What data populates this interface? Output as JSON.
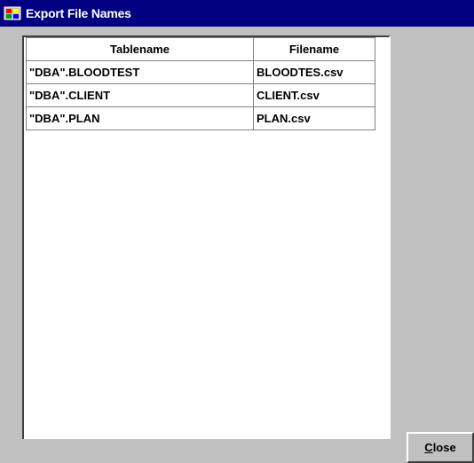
{
  "window": {
    "title": "Export File Names",
    "icon": "app-icon"
  },
  "table": {
    "columns": [
      "Tablename",
      "Filename"
    ],
    "rows": [
      [
        "\"DBA\".BLOODTEST",
        "BLOODTES.csv"
      ],
      [
        "\"DBA\".CLIENT",
        "CLIENT.csv"
      ],
      [
        "\"DBA\".PLAN",
        "PLAN.csv"
      ]
    ]
  },
  "buttons": {
    "close_mnemonic": "C",
    "close_rest": "lose"
  },
  "colors": {
    "titlebar": "#000080",
    "window_bg": "#c0c0c0",
    "list_bg": "#ffffff"
  }
}
